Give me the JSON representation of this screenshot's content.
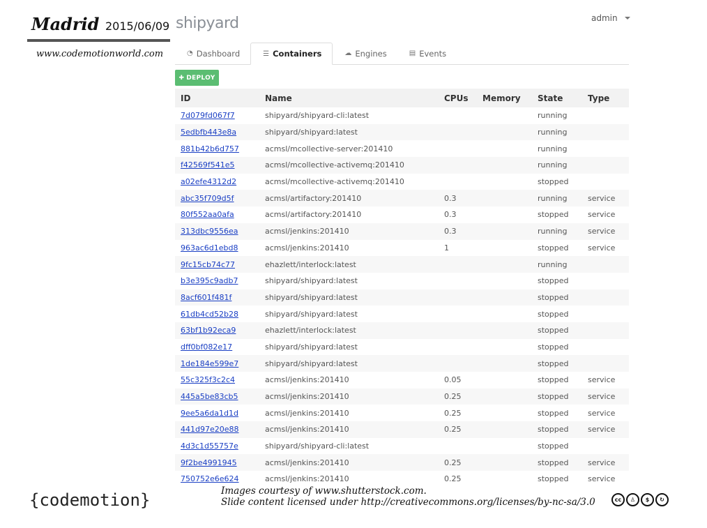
{
  "slide": {
    "city": "Madrid",
    "date": "2015/06/09",
    "website": "www.codemotionworld.com",
    "footer_logo": "{codemotion}",
    "credit_line1": "Images courtesy of www.shutterstock.com.",
    "credit_line2": "Slide content licensed under http://creativecommons.org/licenses/by-nc-sa/3.0",
    "license_icons": [
      "cc-icon",
      "by-icon",
      "nc-icon",
      "sa-icon"
    ]
  },
  "app": {
    "logo": "shipyard",
    "user": "admin",
    "accent_color": "#5bbd72",
    "link_color": "#1a3fc4"
  },
  "tabs": [
    {
      "label": "Dashboard",
      "icon": "dashboard-icon",
      "active": false
    },
    {
      "label": "Containers",
      "icon": "list-icon",
      "active": true
    },
    {
      "label": "Engines",
      "icon": "cloud-icon",
      "active": false
    },
    {
      "label": "Events",
      "icon": "events-icon",
      "active": false
    }
  ],
  "deploy_label": "DEPLOY",
  "table": {
    "headers": {
      "id": "ID",
      "name": "Name",
      "cpus": "CPUs",
      "memory": "Memory",
      "state": "State",
      "type": "Type"
    },
    "rows": [
      {
        "id": "7d079fd067f7",
        "name": "shipyard/shipyard-cli:latest",
        "cpus": "",
        "memory": "",
        "state": "running",
        "type": ""
      },
      {
        "id": "5edbfb443e8a",
        "name": "shipyard/shipyard:latest",
        "cpus": "",
        "memory": "",
        "state": "running",
        "type": ""
      },
      {
        "id": "881b42b6d757",
        "name": "acmsl/mcollective-server:201410",
        "cpus": "",
        "memory": "",
        "state": "running",
        "type": ""
      },
      {
        "id": "f42569f541e5",
        "name": "acmsl/mcollective-activemq:201410",
        "cpus": "",
        "memory": "",
        "state": "running",
        "type": ""
      },
      {
        "id": "a02efe4312d2",
        "name": "acmsl/mcollective-activemq:201410",
        "cpus": "",
        "memory": "",
        "state": "stopped",
        "type": ""
      },
      {
        "id": "abc35f709d5f",
        "name": "acmsl/artifactory:201410",
        "cpus": "0.3",
        "memory": "",
        "state": "running",
        "type": "service"
      },
      {
        "id": "80f552aa0afa",
        "name": "acmsl/artifactory:201410",
        "cpus": "0.3",
        "memory": "",
        "state": "stopped",
        "type": "service"
      },
      {
        "id": "313dbc9556ea",
        "name": "acmsl/jenkins:201410",
        "cpus": "0.3",
        "memory": "",
        "state": "running",
        "type": "service"
      },
      {
        "id": "963ac6d1ebd8",
        "name": "acmsl/jenkins:201410",
        "cpus": "1",
        "memory": "",
        "state": "stopped",
        "type": "service"
      },
      {
        "id": "9fc15cb74c77",
        "name": "ehazlett/interlock:latest",
        "cpus": "",
        "memory": "",
        "state": "running",
        "type": ""
      },
      {
        "id": "b3e395c9adb7",
        "name": "shipyard/shipyard:latest",
        "cpus": "",
        "memory": "",
        "state": "stopped",
        "type": ""
      },
      {
        "id": "8acf601f481f",
        "name": "shipyard/shipyard:latest",
        "cpus": "",
        "memory": "",
        "state": "stopped",
        "type": ""
      },
      {
        "id": "61db4cd52b28",
        "name": "shipyard/shipyard:latest",
        "cpus": "",
        "memory": "",
        "state": "stopped",
        "type": ""
      },
      {
        "id": "63bf1b92eca9",
        "name": "ehazlett/interlock:latest",
        "cpus": "",
        "memory": "",
        "state": "stopped",
        "type": ""
      },
      {
        "id": "dff0bf082e17",
        "name": "shipyard/shipyard:latest",
        "cpus": "",
        "memory": "",
        "state": "stopped",
        "type": ""
      },
      {
        "id": "1de184e599e7",
        "name": "shipyard/shipyard:latest",
        "cpus": "",
        "memory": "",
        "state": "stopped",
        "type": ""
      },
      {
        "id": "55c325f3c2c4",
        "name": "acmsl/jenkins:201410",
        "cpus": "0.05",
        "memory": "",
        "state": "stopped",
        "type": "service"
      },
      {
        "id": "445a5be83cb5",
        "name": "acmsl/jenkins:201410",
        "cpus": "0.25",
        "memory": "",
        "state": "stopped",
        "type": "service"
      },
      {
        "id": "9ee5a6da1d1d",
        "name": "acmsl/jenkins:201410",
        "cpus": "0.25",
        "memory": "",
        "state": "stopped",
        "type": "service"
      },
      {
        "id": "441d97e20e88",
        "name": "acmsl/jenkins:201410",
        "cpus": "0.25",
        "memory": "",
        "state": "stopped",
        "type": "service"
      },
      {
        "id": "4d3c1d55757e",
        "name": "shipyard/shipyard-cli:latest",
        "cpus": "",
        "memory": "",
        "state": "stopped",
        "type": ""
      },
      {
        "id": "9f2be4991945",
        "name": "acmsl/jenkins:201410",
        "cpus": "0.25",
        "memory": "",
        "state": "stopped",
        "type": "service"
      },
      {
        "id": "750752e6e624",
        "name": "acmsl/jenkins:201410",
        "cpus": "0.25",
        "memory": "",
        "state": "stopped",
        "type": "service"
      }
    ]
  }
}
